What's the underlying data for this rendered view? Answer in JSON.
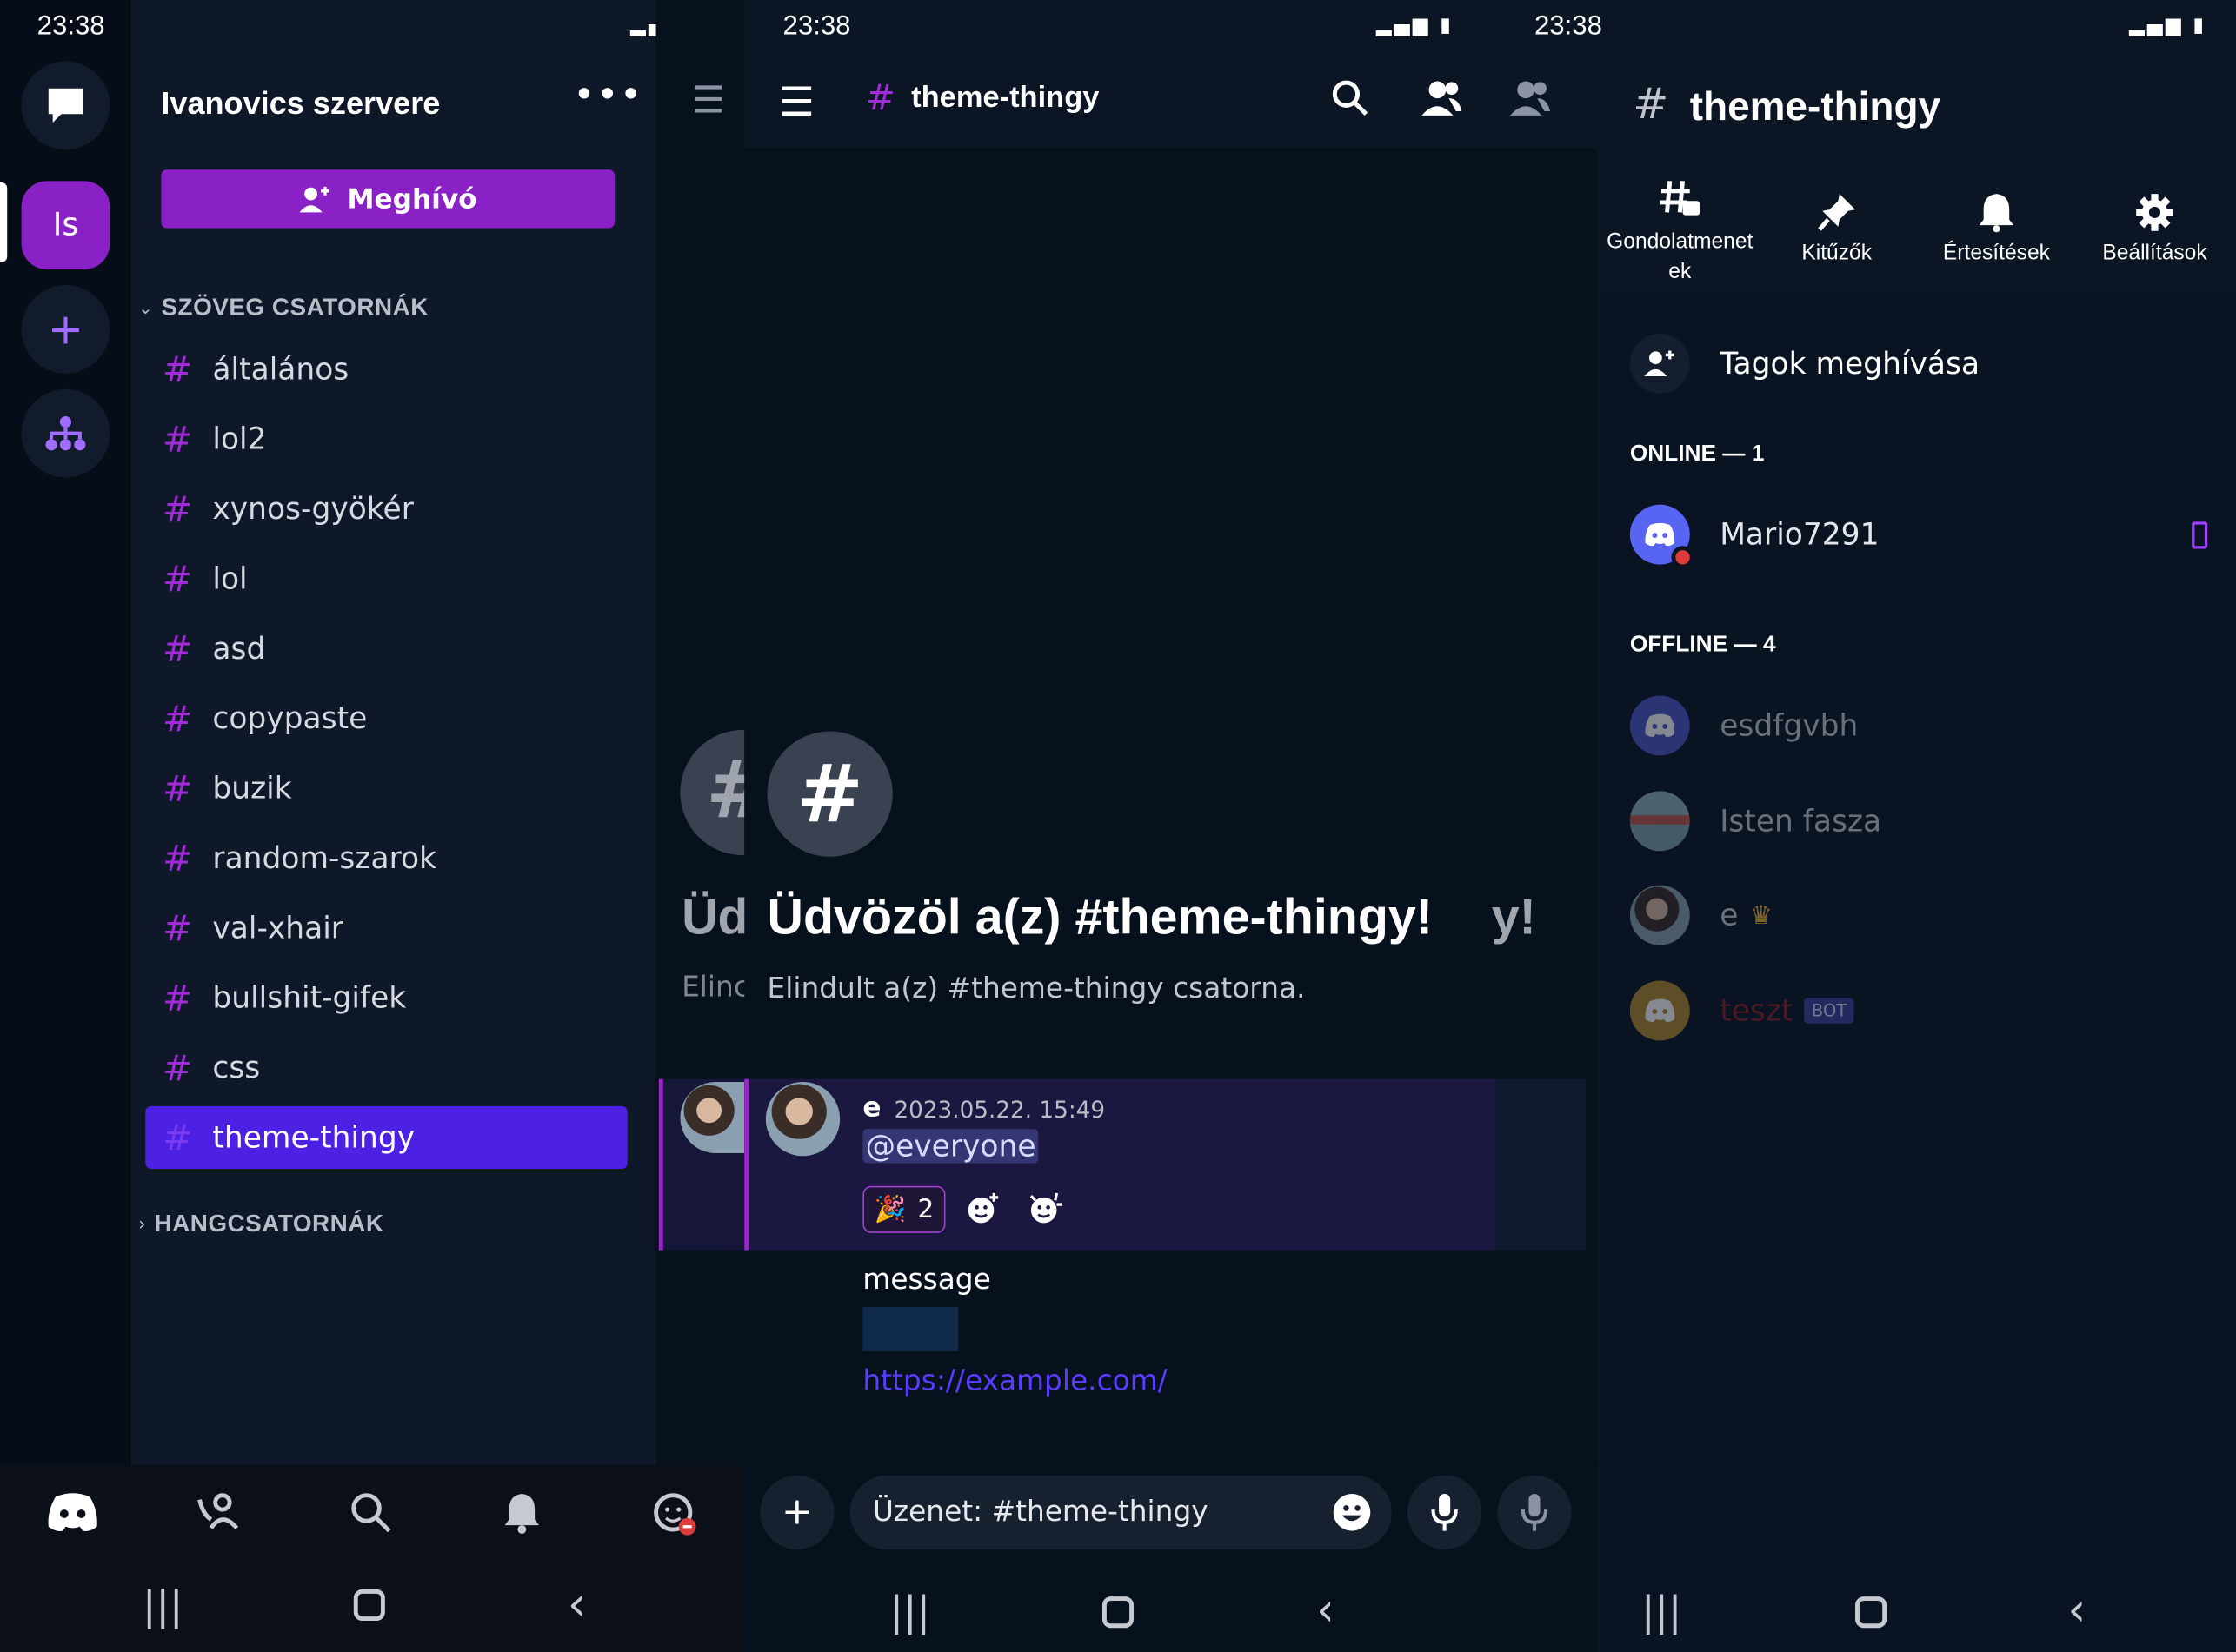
{
  "status_bar": {
    "time": "23:38"
  },
  "left_panel": {
    "server_name": "Ivanovics szervere",
    "server_initials": "Is",
    "invite_label": "Meghívó",
    "text_category": "SZÖVEG CSATORNÁK",
    "voice_category": "HANGCSATORNÁK",
    "channels": [
      {
        "name": "általános"
      },
      {
        "name": "lol2"
      },
      {
        "name": "xynos-gyökér"
      },
      {
        "name": "lol"
      },
      {
        "name": "asd"
      },
      {
        "name": "copypaste"
      },
      {
        "name": "buzik"
      },
      {
        "name": "random-szarok"
      },
      {
        "name": "val-xhair"
      },
      {
        "name": "bullshit-gifek"
      },
      {
        "name": "css"
      },
      {
        "name": "theme-thingy",
        "active": true
      }
    ]
  },
  "middle_panel": {
    "channel_name": "theme-thingy",
    "welcome_title": "Üdvözöl a(z) #theme-thingy!",
    "welcome_sub": "Elindult a(z) #theme-thingy csatorna.",
    "peek_title": "Üd",
    "peek_sub": "Elinc",
    "peek_end": "y!",
    "message": {
      "author": "e",
      "timestamp": "2023.05.22. 15:49",
      "mention": "@everyone",
      "reaction_count": "2",
      "body": "message",
      "link": "https://example.com/"
    },
    "composer_placeholder": "Üzenet: #theme-thingy"
  },
  "right_panel": {
    "channel_name": "theme-thingy",
    "tools": [
      {
        "label": "Gondolatmenet ek",
        "icon": "threads-icon"
      },
      {
        "label": "Kitűzők",
        "icon": "pin-icon"
      },
      {
        "label": "Értesítések",
        "icon": "bell-icon"
      },
      {
        "label": "Beállítások",
        "icon": "gear-icon"
      }
    ],
    "invite_members": "Tagok meghívása",
    "online_title": "ONLINE — 1",
    "offline_title": "OFFLINE — 4",
    "online_members": [
      {
        "name": "Mario7291"
      }
    ],
    "offline_members": [
      {
        "name": "esdfgvbh"
      },
      {
        "name": "Isten fasza"
      },
      {
        "name": "e"
      },
      {
        "name": "teszt",
        "badge": "BOT"
      }
    ]
  },
  "colors": {
    "accent_purple": "#8a21c7",
    "active_channel": "#4c21e3",
    "link": "#5b3cff",
    "background": "#0b1524"
  }
}
